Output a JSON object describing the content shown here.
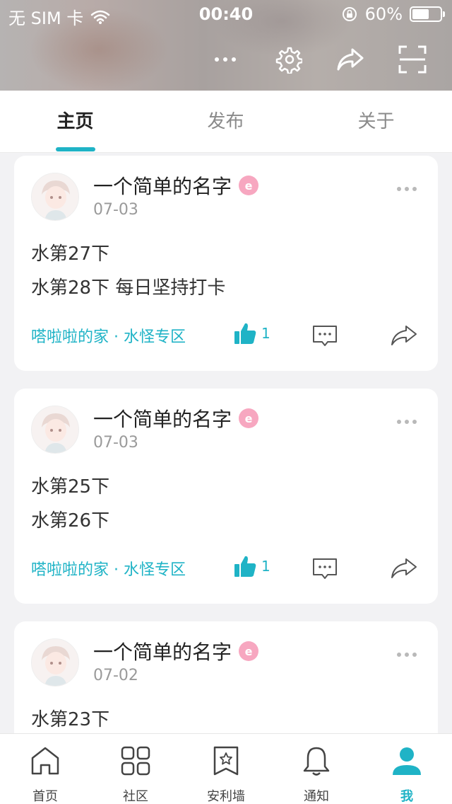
{
  "status": {
    "carrier": "无 SIM 卡",
    "time": "00:40",
    "battery": "60%",
    "battery_level": 0.6
  },
  "header": {
    "icons": [
      "more-icon",
      "settings-gear-icon",
      "share-icon",
      "scan-icon"
    ]
  },
  "tabs": [
    {
      "label": "主页",
      "active": true
    },
    {
      "label": "发布",
      "active": false
    },
    {
      "label": "关于",
      "active": false
    }
  ],
  "posts": [
    {
      "username": "一个简单的名字",
      "date": "07-03",
      "lines": [
        "水第27下",
        "水第28下 每日坚持打卡"
      ],
      "tags": "嗒啦啦的家 · 水怪专区",
      "likes": "1"
    },
    {
      "username": "一个简单的名字",
      "date": "07-03",
      "lines": [
        "水第25下",
        "水第26下"
      ],
      "tags": "嗒啦啦的家 · 水怪专区",
      "likes": "1"
    },
    {
      "username": "一个简单的名字",
      "date": "07-02",
      "lines": [
        "水第23下"
      ],
      "tags": "",
      "likes": ""
    }
  ],
  "nav": [
    {
      "label": "首页",
      "icon": "home-icon",
      "active": false
    },
    {
      "label": "社区",
      "icon": "grid-icon",
      "active": false
    },
    {
      "label": "安利墙",
      "icon": "bookmark-star-icon",
      "active": false
    },
    {
      "label": "通知",
      "icon": "bell-icon",
      "active": false
    },
    {
      "label": "我",
      "icon": "user-icon",
      "active": true
    }
  ],
  "colors": {
    "accent": "#1fb3c6",
    "badge": "#f7a7c0"
  }
}
